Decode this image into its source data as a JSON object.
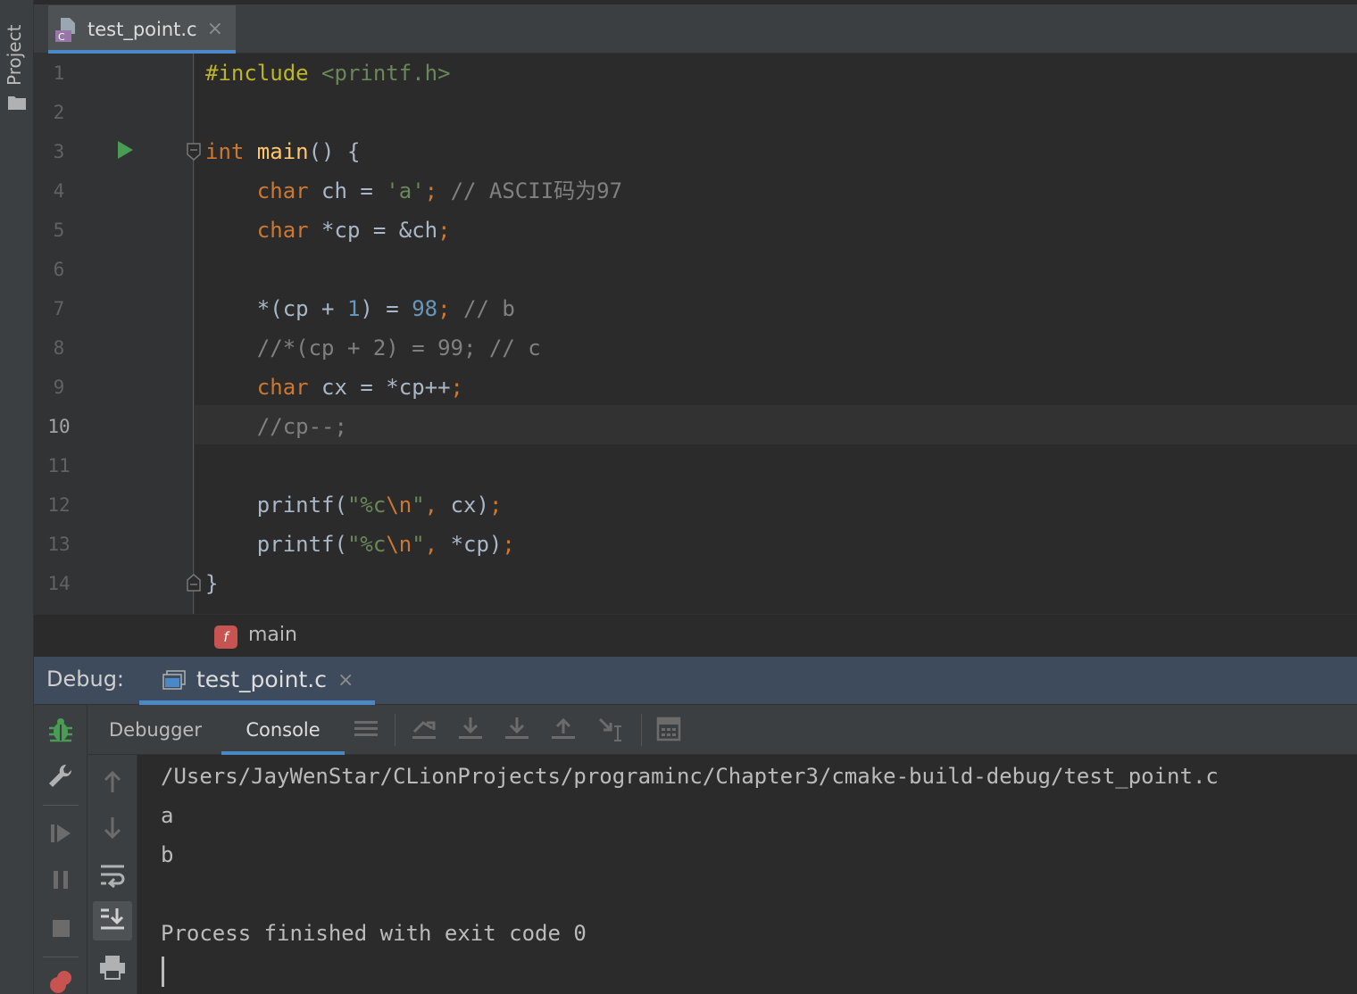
{
  "sidebar": {
    "project_label": "Project"
  },
  "editor_tab": {
    "label": "test_point.c",
    "close": "×",
    "file_badge": "C"
  },
  "editor": {
    "line_numbers": [
      "1",
      "2",
      "3",
      "4",
      "5",
      "6",
      "7",
      "8",
      "9",
      "10",
      "11",
      "12",
      "13",
      "14"
    ],
    "current_line": "10",
    "lines": [
      [
        {
          "t": "#include ",
          "c": "pp"
        },
        {
          "t": "<printf.h>",
          "c": "str"
        }
      ],
      [],
      [
        {
          "t": "int ",
          "c": "kw"
        },
        {
          "t": "main",
          "c": "fn"
        },
        {
          "t": "() {",
          "c": ""
        }
      ],
      [
        {
          "t": "    ",
          "c": ""
        },
        {
          "t": "char ",
          "c": "kw"
        },
        {
          "t": "ch = ",
          "c": ""
        },
        {
          "t": "'a'",
          "c": "str"
        },
        {
          "t": "; ",
          "c": "kw"
        },
        {
          "t": "// ASCII码为97",
          "c": "com"
        }
      ],
      [
        {
          "t": "    ",
          "c": ""
        },
        {
          "t": "char ",
          "c": "kw"
        },
        {
          "t": "*cp = &ch",
          "c": ""
        },
        {
          "t": ";",
          "c": "kw"
        }
      ],
      [],
      [
        {
          "t": "    ",
          "c": ""
        },
        {
          "t": "*(cp + ",
          "c": ""
        },
        {
          "t": "1",
          "c": "num"
        },
        {
          "t": ") = ",
          "c": ""
        },
        {
          "t": "98",
          "c": "num"
        },
        {
          "t": "; ",
          "c": "kw"
        },
        {
          "t": "// b",
          "c": "com"
        }
      ],
      [
        {
          "t": "    ",
          "c": ""
        },
        {
          "t": "//*(cp + 2) = 99; // c",
          "c": "com"
        }
      ],
      [
        {
          "t": "    ",
          "c": ""
        },
        {
          "t": "char ",
          "c": "kw"
        },
        {
          "t": "cx = *cp++",
          "c": ""
        },
        {
          "t": ";",
          "c": "kw"
        }
      ],
      [
        {
          "t": "    ",
          "c": ""
        },
        {
          "t": "//cp--;",
          "c": "com"
        }
      ],
      [],
      [
        {
          "t": "    ",
          "c": ""
        },
        {
          "t": "printf(",
          "c": ""
        },
        {
          "t": "\"%c",
          "c": "str"
        },
        {
          "t": "\\n",
          "c": "esc"
        },
        {
          "t": "\"",
          "c": "str"
        },
        {
          "t": ", ",
          "c": "kw"
        },
        {
          "t": "cx)",
          "c": ""
        },
        {
          "t": ";",
          "c": "kw"
        }
      ],
      [
        {
          "t": "    ",
          "c": ""
        },
        {
          "t": "printf(",
          "c": ""
        },
        {
          "t": "\"%c",
          "c": "str"
        },
        {
          "t": "\\n",
          "c": "esc"
        },
        {
          "t": "\"",
          "c": "str"
        },
        {
          "t": ", ",
          "c": "kw"
        },
        {
          "t": "*cp)",
          "c": ""
        },
        {
          "t": ";",
          "c": "kw"
        }
      ],
      [
        {
          "t": "}",
          "c": ""
        }
      ]
    ]
  },
  "breadcrumb": {
    "badge": "f",
    "label": "main"
  },
  "debug": {
    "label": "Debug:",
    "tab_label": "test_point.c",
    "tab_close": "×",
    "subtabs": [
      "Debugger",
      "Console"
    ],
    "active_subtab": "Console"
  },
  "console": {
    "lines": [
      "/Users/JayWenStar/CLionProjects/programinc/Chapter3/cmake-build-debug/test_point.c",
      "a",
      "b",
      "",
      "Process finished with exit code 0"
    ]
  },
  "colors": {
    "accent": "#4a88c7",
    "run_green": "#499c54",
    "debug_header": "#3d4b5c"
  }
}
